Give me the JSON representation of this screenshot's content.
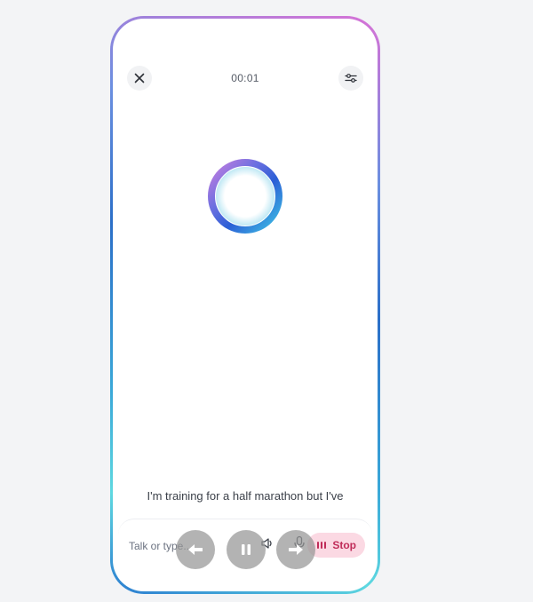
{
  "header": {
    "timer": "00:01"
  },
  "transcript": {
    "text": "I'm training for a half marathon but I've"
  },
  "input_bar": {
    "placeholder": "Talk or type..."
  },
  "controls": {
    "stop_label": "Stop"
  },
  "icons": {
    "close": "close-icon",
    "settings": "sliders-icon",
    "back": "arrow-left-icon",
    "pause": "pause-icon",
    "forward": "arrow-right-icon",
    "speaker": "speaker-icon",
    "mic": "microphone-icon",
    "audio_bars": "audio-bars-icon"
  },
  "colors": {
    "accent_stop_bg": "#fbd9e3",
    "accent_stop_text": "#c02c59",
    "frame_gradient_top": "#d872d6",
    "frame_gradient_mid": "#2b6fc8",
    "frame_gradient_low": "#5ed8e0"
  }
}
